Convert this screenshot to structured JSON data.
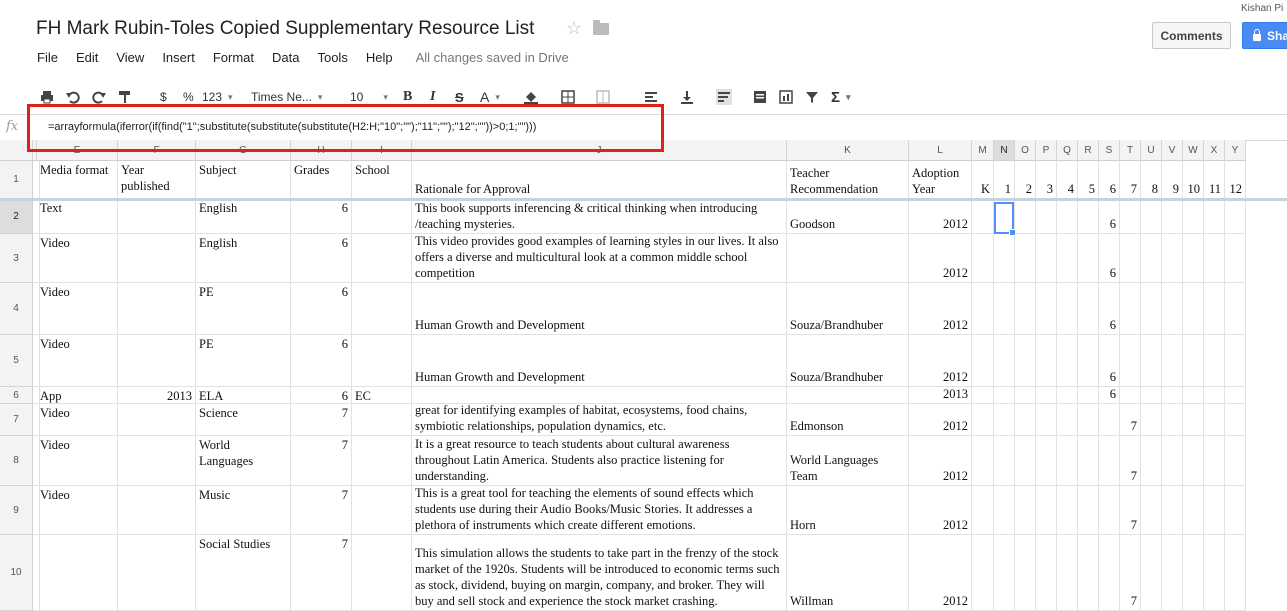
{
  "document": {
    "title": "FH Mark Rubin-Toles Copied Supplementary Resource List",
    "user": "Kishan Pi",
    "comments_label": "Comments",
    "share_label": "Sha"
  },
  "menu": {
    "items": [
      "File",
      "Edit",
      "View",
      "Insert",
      "Format",
      "Data",
      "Tools",
      "Help"
    ],
    "save_status": "All changes saved in Drive"
  },
  "toolbar": {
    "currency": "$",
    "percent": "%",
    "number_format": "123",
    "font": "Times Ne...",
    "font_size": "10",
    "bold": "B",
    "italic": "I",
    "strike": "S",
    "text_color": "A",
    "sigma": "Σ"
  },
  "formula_bar": {
    "fx": "fx",
    "formula": "=arrayformula(iferror(if(find(\"1\";substitute(substitute(substitute(H2:H;\"10\";\"\");\"11\";\"\");\"12\";\"\"))>0;1;\"\")))"
  },
  "columns": [
    "E",
    "F",
    "G",
    "H",
    "I",
    "J",
    "K",
    "L",
    "M",
    "N",
    "O",
    "P",
    "Q",
    "R",
    "S",
    "T",
    "U",
    "V",
    "W",
    "X",
    "Y"
  ],
  "selected_column": "N",
  "selected_row": "2",
  "header_row": {
    "row_num": "1",
    "cells": [
      "Media format",
      "Year published",
      "Subject",
      "Grades",
      "School",
      "Rationale for Approval",
      "Teacher Recommendation",
      "Adoption Year",
      "K",
      "1",
      "2",
      "3",
      "4",
      "5",
      "6",
      "7",
      "8",
      "9",
      "10",
      "11",
      "12"
    ]
  },
  "rows": [
    {
      "num": "2",
      "media": "Text",
      "year": "",
      "subject": "English",
      "grades": "6",
      "school": "",
      "rationale": "This book supports inferencing & critical thinking when introducing /teaching mysteries.",
      "teacher": "Goodson",
      "adoption": "2012",
      "g6": "6",
      "g7": ""
    },
    {
      "num": "3",
      "media": "Video",
      "year": "",
      "subject": "English",
      "grades": "6",
      "school": "",
      "rationale": "This video provides good examples of learning styles in our lives. It also offers a diverse and multicultural look at a common middle school competition",
      "teacher": "",
      "adoption": "2012",
      "g6": "6",
      "g7": ""
    },
    {
      "num": "4",
      "media": "Video",
      "year": "",
      "subject": "PE",
      "grades": "6",
      "school": "",
      "rationale": "Human Growth and Development",
      "teacher": "Souza/Brandhuber",
      "adoption": "2012",
      "g6": "6",
      "g7": ""
    },
    {
      "num": "5",
      "media": "Video",
      "year": "",
      "subject": "PE",
      "grades": "6",
      "school": "",
      "rationale": "Human Growth and Development",
      "teacher": "Souza/Brandhuber",
      "adoption": "2012",
      "g6": "6",
      "g7": ""
    },
    {
      "num": "6",
      "media": "App",
      "year": "2013",
      "subject": "ELA",
      "grades": "6",
      "school": "EC",
      "rationale": "",
      "teacher": "",
      "adoption": "2013",
      "g6": "6",
      "g7": ""
    },
    {
      "num": "7",
      "media": "Video",
      "year": "",
      "subject": "Science",
      "grades": "7",
      "school": "",
      "rationale": "great for identifying examples of habitat, ecosystems, food chains, symbiotic relationships, population dynamics, etc.",
      "teacher": "Edmonson",
      "adoption": "2012",
      "g6": "",
      "g7": "7"
    },
    {
      "num": "8",
      "media": "Video",
      "year": "",
      "subject": "World Languages",
      "grades": "7",
      "school": "",
      "rationale": "It is a great resource to teach students about cultural awareness throughout Latin America. Students also practice listening for understanding.",
      "teacher": "World Languages Team",
      "adoption": "2012",
      "g6": "",
      "g7": "7"
    },
    {
      "num": "9",
      "media": "Video",
      "year": "",
      "subject": "Music",
      "grades": "7",
      "school": "",
      "rationale": "This is a great tool for teaching the elements of sound effects which students use during their Audio Books/Music Stories. It addresses a plethora of instruments which create different emotions.",
      "teacher": "Horn",
      "adoption": "2012",
      "g6": "",
      "g7": "7"
    },
    {
      "num": "10",
      "media": "",
      "year": "",
      "subject": "Social Studies",
      "grades": "7",
      "school": "",
      "rationale": "This simulation allows the students to take part in the frenzy of the stock market of the 1920s. Students will be introduced to economic terms such as stock, dividend, buying on margin, company, and broker. They will buy and sell stock and experience the stock market crashing.",
      "teacher": "Willman",
      "adoption": "2012",
      "g6": "",
      "g7": "7"
    }
  ]
}
